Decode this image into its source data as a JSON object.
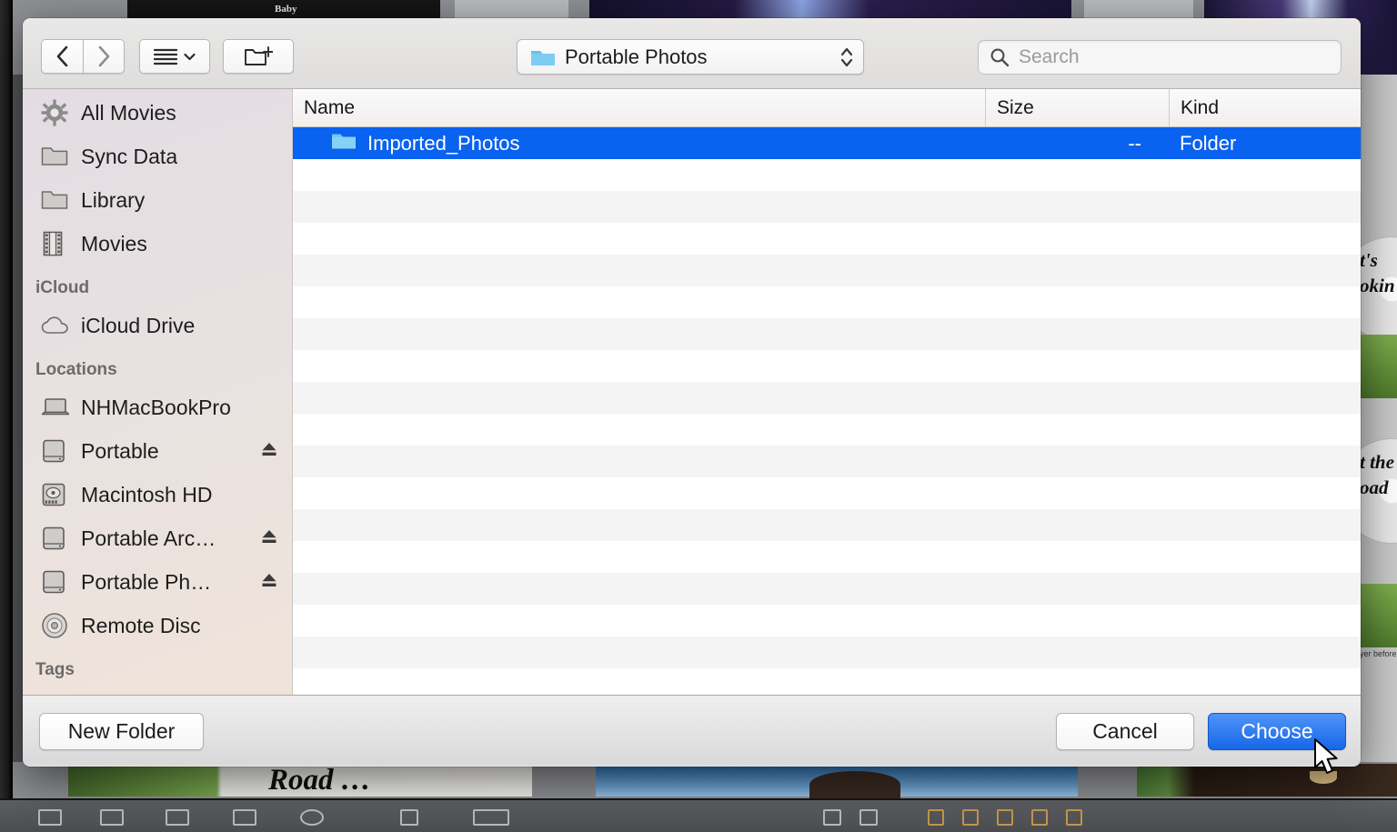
{
  "dialog": {
    "title": "Open / Choose folder dialog",
    "toolbar": {
      "back_label": "Back",
      "forward_label": "Forward",
      "view_options_label": "View options",
      "new_folder_icon_label": "New Folder",
      "path_popup": {
        "value": "Portable Photos",
        "icon": "folder-icon"
      },
      "search": {
        "placeholder": "Search",
        "value": "",
        "icon": "search-icon"
      }
    },
    "sidebar": {
      "groups": [
        {
          "header": "",
          "items": [
            {
              "label": "All Movies",
              "icon": "gear-icon",
              "eject": false
            },
            {
              "label": "Sync Data",
              "icon": "folder-icon",
              "eject": false
            },
            {
              "label": "Library",
              "icon": "folder-icon",
              "eject": false
            },
            {
              "label": "Movies",
              "icon": "film-icon",
              "eject": false
            }
          ]
        },
        {
          "header": "iCloud",
          "items": [
            {
              "label": "iCloud Drive",
              "icon": "cloud-icon",
              "eject": false
            }
          ]
        },
        {
          "header": "Locations",
          "items": [
            {
              "label": "NHMacBookPro",
              "icon": "laptop-icon",
              "eject": false
            },
            {
              "label": "Portable",
              "icon": "harddisk-icon",
              "eject": true
            },
            {
              "label": "Macintosh HD",
              "icon": "internaldisk-icon",
              "eject": false
            },
            {
              "label": "Portable Arc…",
              "icon": "harddisk-icon",
              "eject": true
            },
            {
              "label": "Portable Ph…",
              "icon": "harddisk-icon",
              "eject": true
            },
            {
              "label": "Remote Disc",
              "icon": "optical-icon",
              "eject": false
            }
          ]
        },
        {
          "header": "Tags",
          "items": []
        }
      ]
    },
    "filelist": {
      "columns": [
        "Name",
        "Size",
        "Kind"
      ],
      "rows": [
        {
          "name": "Imported_Photos",
          "size": "--",
          "kind": "Folder",
          "icon": "folder-icon",
          "selected": true
        }
      ],
      "empty_row_count": 17
    },
    "bottombar": {
      "new_folder_label": "New Folder",
      "cancel_label": "Cancel",
      "choose_label": "Choose"
    },
    "colors": {
      "selection_blue": "#0a62f0",
      "default_button_blue": "#1667e8",
      "folder_blue": "#6cc6f0",
      "sidebar_tint": "#e6e0e2"
    }
  },
  "background": {
    "app_hint": "media/DVD authoring application behind dialog",
    "disc_note_line1": "t's",
    "disc_note_line2": "okin",
    "disc_note_line3": "t the",
    "disc_note_line4": "oad",
    "disc_caption": "yer before",
    "bottom_thumb_label": "Road …",
    "top_thumb_label": "Baby"
  }
}
